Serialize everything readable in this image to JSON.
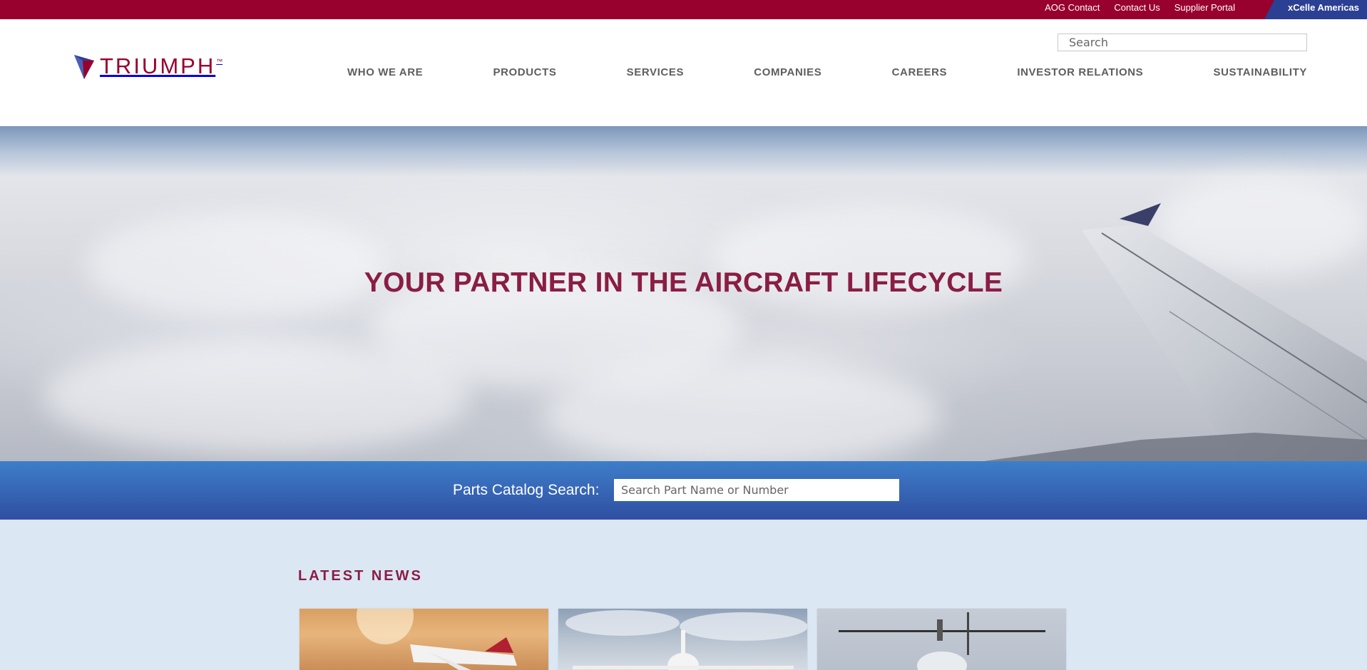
{
  "utility_bar": {
    "links": [
      "AOG Contact",
      "Contact Us",
      "Supplier Portal"
    ],
    "region": "xCelle Americas"
  },
  "header": {
    "logo_text": "TRIUMPH",
    "logo_tm": "™",
    "search_placeholder": "Search",
    "nav": [
      "WHO WE ARE",
      "PRODUCTS",
      "SERVICES",
      "COMPANIES",
      "CAREERS",
      "INVESTOR RELATIONS",
      "SUSTAINABILITY"
    ]
  },
  "hero": {
    "title": "YOUR PARTNER IN THE AIRCRAFT LIFECYCLE"
  },
  "parts_search": {
    "label": "Parts Catalog Search:",
    "placeholder": "Search Part Name or Number"
  },
  "news": {
    "title": "LATEST NEWS"
  },
  "colors": {
    "brand_crimson": "#98002e",
    "brand_blue": "#2b3f93",
    "hero_title": "#8a1d43",
    "news_background": "#dce7f4"
  }
}
